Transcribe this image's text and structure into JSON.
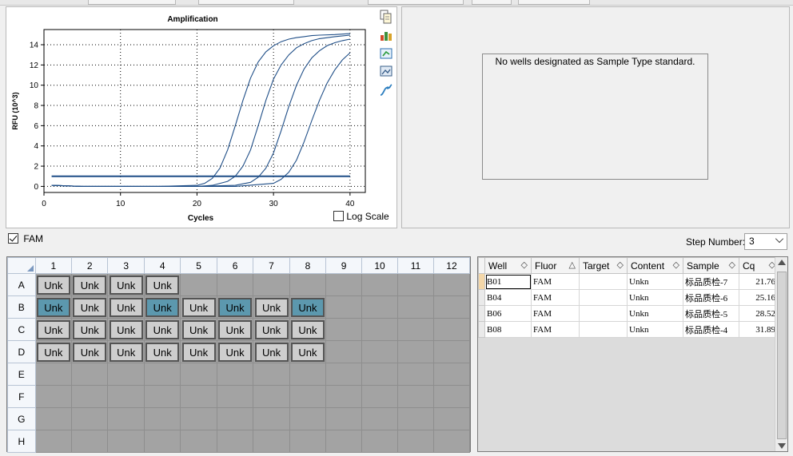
{
  "chart_data": {
    "type": "line",
    "title": "Amplification",
    "xlabel": "Cycles",
    "ylabel": "RFU (10^3)",
    "xlim": [
      0,
      42
    ],
    "ylim": [
      -0.6,
      15.5
    ],
    "xticks": [
      0,
      10,
      20,
      30,
      40
    ],
    "yticks": [
      0,
      2,
      4,
      6,
      8,
      10,
      12,
      14
    ],
    "grid": true,
    "threshold": 1.0,
    "series": [
      {
        "x": [
          1,
          5,
          10,
          15,
          20,
          21,
          22,
          23,
          24,
          25,
          26,
          27,
          28,
          29,
          30,
          31,
          32,
          33,
          34,
          35,
          36,
          38,
          40
        ],
        "y": [
          0.1,
          0.0,
          0.0,
          0.0,
          0.1,
          0.3,
          0.8,
          1.8,
          3.6,
          6.0,
          8.5,
          10.7,
          12.3,
          13.3,
          13.9,
          14.3,
          14.55,
          14.7,
          14.8,
          14.9,
          14.95,
          15.0,
          15.1
        ]
      },
      {
        "x": [
          1,
          5,
          10,
          15,
          20,
          22,
          24,
          25,
          26,
          27,
          28,
          29,
          30,
          31,
          32,
          33,
          34,
          35,
          36,
          38,
          40
        ],
        "y": [
          0.1,
          0.0,
          0.0,
          0.0,
          0.0,
          0.1,
          0.5,
          1.0,
          2.0,
          3.6,
          6.0,
          8.5,
          10.6,
          12.0,
          13.0,
          13.7,
          14.1,
          14.4,
          14.6,
          14.8,
          14.95
        ]
      },
      {
        "x": [
          1,
          5,
          10,
          15,
          20,
          25,
          27,
          28,
          29,
          30,
          31,
          32,
          33,
          34,
          35,
          36,
          37,
          38,
          39,
          40
        ],
        "y": [
          0.1,
          0.0,
          0.0,
          0.0,
          0.0,
          0.1,
          0.4,
          0.9,
          1.8,
          3.3,
          5.5,
          7.9,
          10.0,
          11.6,
          12.7,
          13.4,
          13.9,
          14.2,
          14.4,
          14.55
        ]
      },
      {
        "x": [
          1,
          5,
          10,
          15,
          20,
          25,
          30,
          31,
          32,
          33,
          34,
          35,
          36,
          37,
          38,
          39,
          40
        ],
        "y": [
          0.1,
          0.0,
          0.0,
          0.0,
          0.0,
          0.0,
          0.3,
          0.7,
          1.4,
          2.6,
          4.4,
          6.5,
          8.5,
          10.2,
          11.5,
          12.5,
          13.2
        ]
      }
    ]
  },
  "chart": {
    "log_scale_label": "Log Scale"
  },
  "standard": {
    "message": "No wells designated as Sample Type standard."
  },
  "filter": {
    "fluor_label": "FAM",
    "step_label": "Step Number:",
    "step_value": "3"
  },
  "plate": {
    "columns": [
      "1",
      "2",
      "3",
      "4",
      "5",
      "6",
      "7",
      "8",
      "9",
      "10",
      "11",
      "12"
    ],
    "rows": [
      {
        "label": "A",
        "cells": [
          "Unk",
          "Unk",
          "Unk",
          "Unk",
          "",
          "",
          "",
          "",
          "",
          "",
          "",
          ""
        ]
      },
      {
        "label": "B",
        "cells": [
          "Unk",
          "Unk",
          "Unk",
          "Unk",
          "Unk",
          "Unk",
          "Unk",
          "Unk",
          "",
          "",
          "",
          ""
        ]
      },
      {
        "label": "C",
        "cells": [
          "Unk",
          "Unk",
          "Unk",
          "Unk",
          "Unk",
          "Unk",
          "Unk",
          "Unk",
          "",
          "",
          "",
          ""
        ]
      },
      {
        "label": "D",
        "cells": [
          "Unk",
          "Unk",
          "Unk",
          "Unk",
          "Unk",
          "Unk",
          "Unk",
          "Unk",
          "",
          "",
          "",
          ""
        ]
      },
      {
        "label": "E",
        "cells": [
          "",
          "",
          "",
          "",
          "",
          "",
          "",
          "",
          "",
          "",
          "",
          ""
        ]
      },
      {
        "label": "F",
        "cells": [
          "",
          "",
          "",
          "",
          "",
          "",
          "",
          "",
          "",
          "",
          "",
          ""
        ]
      },
      {
        "label": "G",
        "cells": [
          "",
          "",
          "",
          "",
          "",
          "",
          "",
          "",
          "",
          "",
          "",
          ""
        ]
      },
      {
        "label": "H",
        "cells": [
          "",
          "",
          "",
          "",
          "",
          "",
          "",
          "",
          "",
          "",
          "",
          ""
        ]
      }
    ],
    "selected": [
      "B1",
      "B4",
      "B6",
      "B8"
    ]
  },
  "grid": {
    "headers": [
      "Well",
      "Fluor",
      "Target",
      "Content",
      "Sample",
      "Cq"
    ],
    "rows": [
      [
        "B01",
        "FAM",
        "",
        "Unkn",
        "标品质检-7",
        "21.76"
      ],
      [
        "B04",
        "FAM",
        "",
        "Unkn",
        "标品质检-6",
        "25.16"
      ],
      [
        "B06",
        "FAM",
        "",
        "Unkn",
        "标品质检-5",
        "28.52"
      ],
      [
        "B08",
        "FAM",
        "",
        "Unkn",
        "标品质检-4",
        "31.89"
      ]
    ]
  },
  "colors": {
    "curve": "#1f4e87",
    "threshold": "#1f4e87",
    "selected_well": "#5c98ae",
    "well": "#cecece"
  }
}
